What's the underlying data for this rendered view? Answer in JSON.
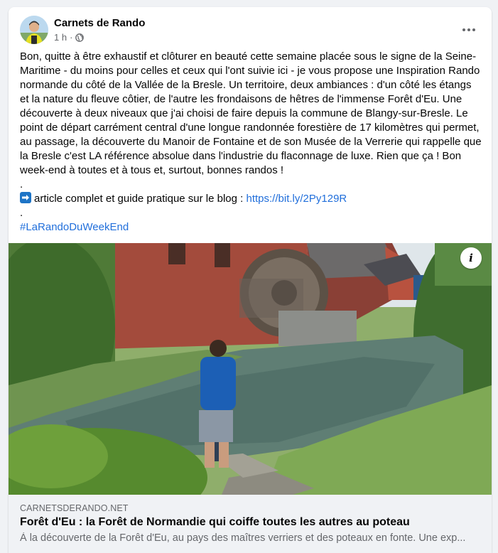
{
  "post": {
    "author": "Carnets de Rando",
    "time": "1 h",
    "time_separator": "·",
    "privacy_icon": "globe-icon",
    "menu_icon": "more-horizontal-icon",
    "paragraphs": [
      "Bon, quitte à être exhaustif et clôturer en beauté cette semaine placée sous le signe de la Seine-Maritime - du moins pour celles et ceux qui l'ont suivie ici - je vous propose une Inspiration Rando normande du côté de la Vallée de la Bresle.  Un territoire, deux ambiances : d'un côté les étangs et la nature du fleuve côtier, de l'autre les frondaisons de hêtres de l'immense Forêt d'Eu. Une découverte à deux niveaux que j'ai choisi de faire depuis la commune de Blangy-sur-Bresle. Le point de départ carrément central d'une longue randonnée forestière de 17 kilomètres qui permet, au passage, la découverte du Manoir de Fontaine et de son Musée de la Verrerie qui rappelle que la Bresle c'est LA référence absolue dans l'industrie du flaconnage de luxe. Rien que ça ! Bon week-end à toutes et à tous et, surtout, bonnes randos !"
    ],
    "separator_dot": ".",
    "article_prefix": "article complet et guide pratique sur le blog : ",
    "article_url": "https://bit.ly/2Py129R",
    "hashtag": "#LaRandoDuWeekEnd"
  },
  "link_preview": {
    "domain": "CARNETSDERANDO.NET",
    "title": "Forêt d'Eu : la Forêt de Normandie qui coiffe toutes les autres au poteau",
    "description": "À la découverte de la Forêt d'Eu, au pays des maîtres verriers et des poteaux en fonte. Une exp...",
    "info_label": "i"
  },
  "colors": {
    "link": "#216fdb",
    "secondary_text": "#65676b",
    "card_background": "#f0f2f5"
  }
}
